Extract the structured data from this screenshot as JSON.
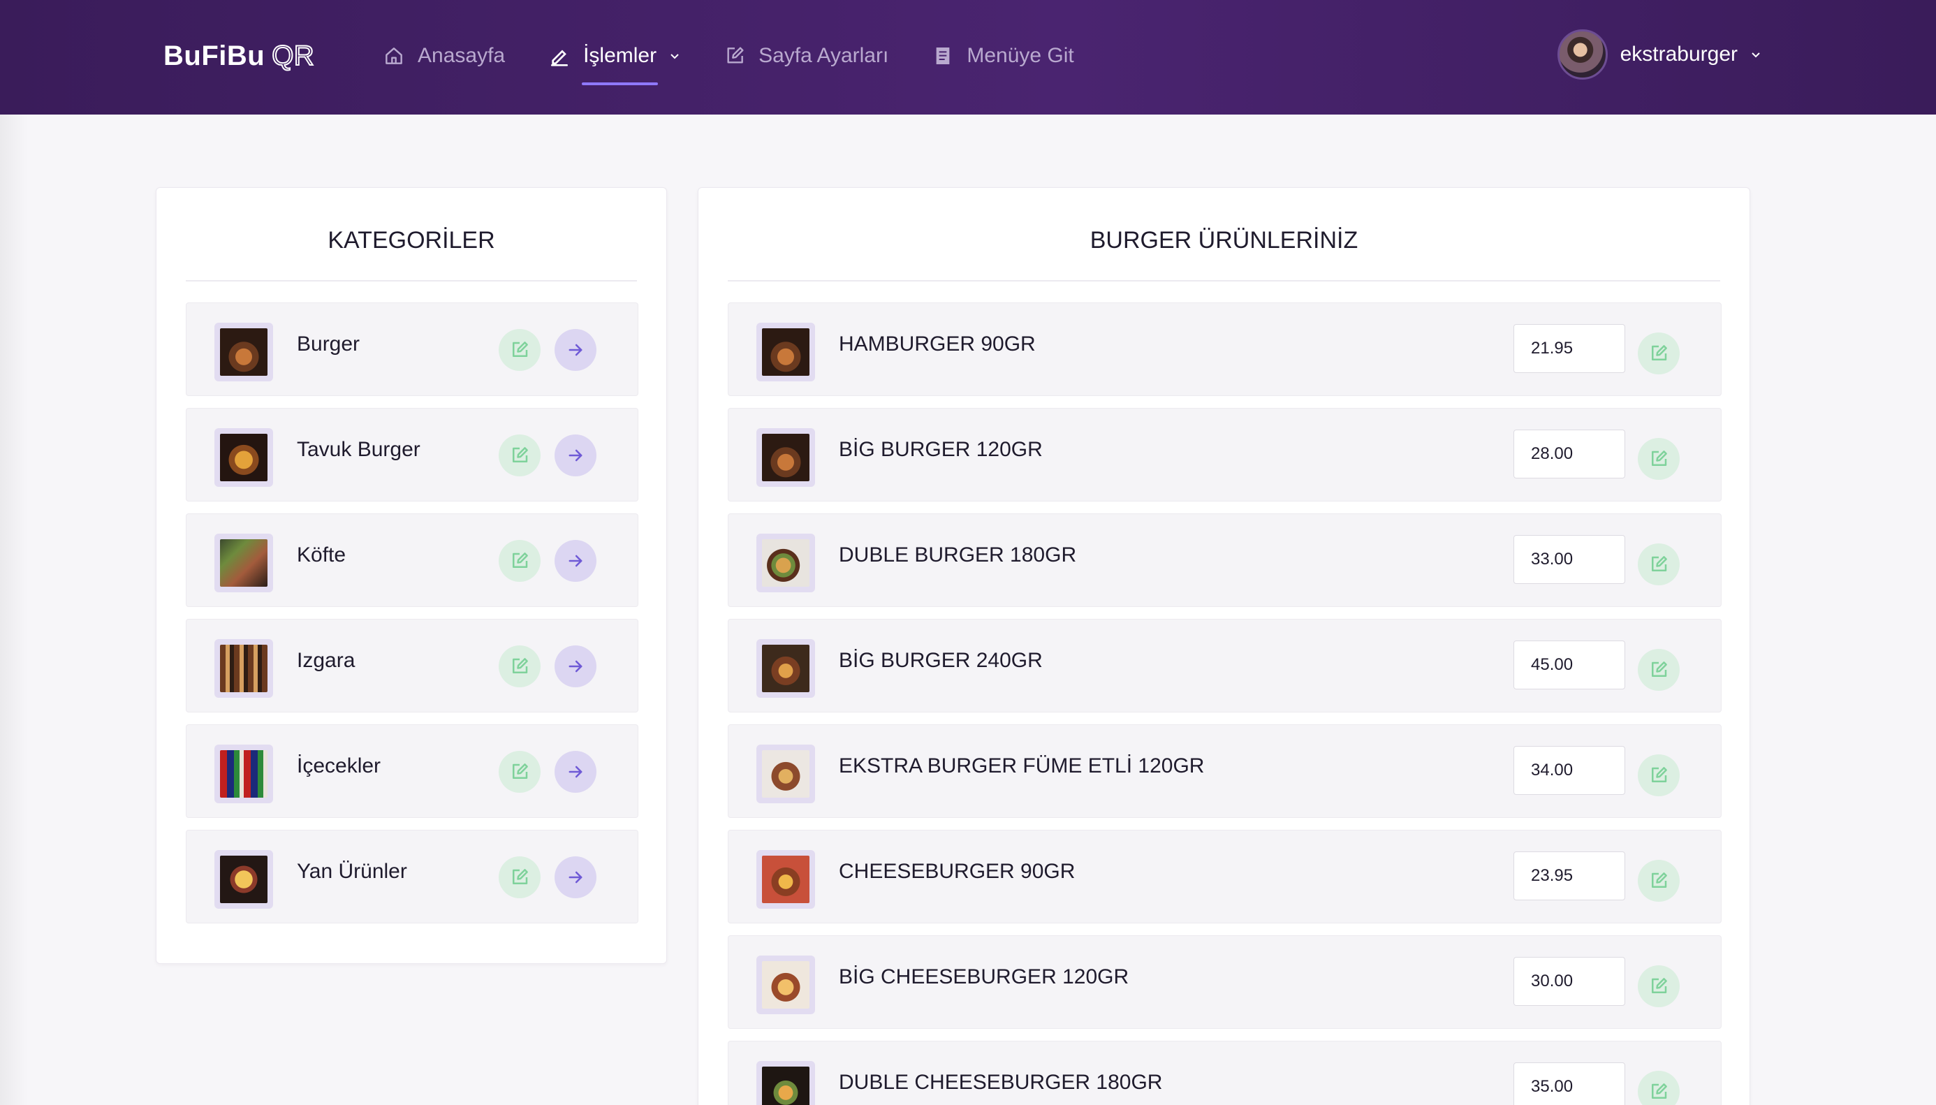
{
  "brand": {
    "name": "BuFiBu",
    "suffix": "QR"
  },
  "nav": {
    "items": [
      {
        "label": "Anasayfa",
        "icon": "home-icon",
        "active": false
      },
      {
        "label": "İşlemler",
        "icon": "pencil-icon",
        "active": true,
        "dropdown": true
      },
      {
        "label": "Sayfa Ayarları",
        "icon": "edit-square-icon",
        "active": false
      },
      {
        "label": "Menüye Git",
        "icon": "book-icon",
        "active": false
      }
    ]
  },
  "user": {
    "name": "ekstraburger"
  },
  "categories": {
    "title": "KATEGORİLER",
    "items": [
      {
        "label": "Burger",
        "thumb": "burger-thumbnail"
      },
      {
        "label": "Tavuk Burger",
        "thumb": "chicken-burger-thumbnail"
      },
      {
        "label": "Köfte",
        "thumb": "meatball-thumbnail"
      },
      {
        "label": "Izgara",
        "thumb": "grill-thumbnail"
      },
      {
        "label": "İçecekler",
        "thumb": "drinks-thumbnail"
      },
      {
        "label": "Yan Ürünler",
        "thumb": "sides-thumbnail"
      }
    ]
  },
  "products": {
    "title": "BURGER ÜRÜNLERİNİZ",
    "items": [
      {
        "name": "HAMBURGER 90GR",
        "price": "21.95"
      },
      {
        "name": "BİG BURGER 120GR",
        "price": "28.00"
      },
      {
        "name": "DUBLE BURGER 180GR",
        "price": "33.00"
      },
      {
        "name": "BİG BURGER 240GR",
        "price": "45.00"
      },
      {
        "name": "EKSTRA BURGER FÜME ETLİ 120GR",
        "price": "34.00"
      },
      {
        "name": "CHEESEBURGER 90GR",
        "price": "23.95"
      },
      {
        "name": "BİG CHEESEBURGER 120GR",
        "price": "30.00"
      },
      {
        "name": "DUBLE CHEESEBURGER 180GR",
        "price": "35.00"
      }
    ]
  },
  "colors": {
    "navbar": "#3a1c5a",
    "accent": "#8f79ff",
    "edit_button_bg": "#dcefe2",
    "edit_icon": "#7fd29b",
    "go_button_bg": "#dcd6f2",
    "go_icon": "#6f5ad6"
  }
}
